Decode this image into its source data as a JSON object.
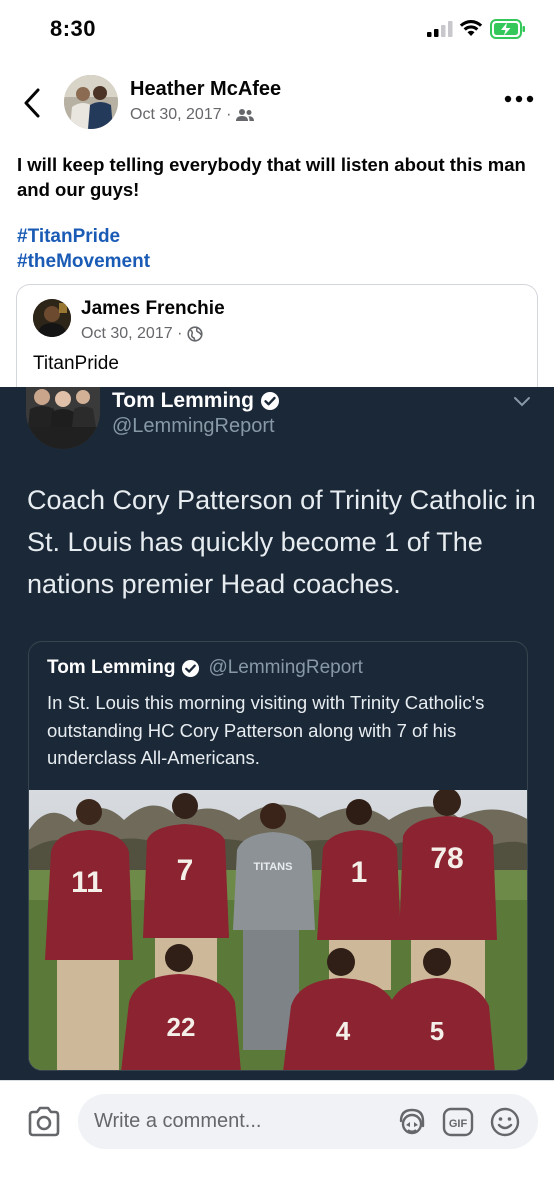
{
  "status_bar": {
    "time": "8:30"
  },
  "post": {
    "author": "Heather McAfee",
    "date": "Oct 30, 2017 ·",
    "text": "I will keep telling everybody that will listen about this man and our guys!",
    "hashtags": [
      "#TitanPride",
      "#theMovement"
    ],
    "icons": {
      "back": "chevron-left-icon",
      "audience": "friends-icon",
      "more": "more-icon"
    }
  },
  "shared": {
    "author": "James Frenchie",
    "date": "Oct 30, 2017 ·",
    "text": "TitanPride",
    "audience_icon": "globe-icon"
  },
  "tweet": {
    "name": "Tom Lemming",
    "handle": "@LemmingReport",
    "text": "Coach Cory Patterson of Trinity Catholic in St. Louis has quickly become 1 of The nations premier Head coaches.",
    "quote": {
      "name": "Tom Lemming",
      "handle": "@LemmingReport",
      "text": "In St. Louis this morning visiting with Trinity Catholic's outstanding HC Cory Patterson along with 7 of his underclass All-Americans."
    },
    "jersey_numbers": [
      "11",
      "7",
      "1",
      "78",
      "22",
      "4",
      "5"
    ],
    "coach_shirt_text": "TITANS"
  },
  "comment_bar": {
    "placeholder": "Write a comment...",
    "gif_label": "GIF"
  },
  "colors": {
    "hashtag": "#1a5bb5",
    "tweet_bg": "#1b2837",
    "meta_gray": "#65676b",
    "battery_green": "#34c759",
    "jersey_maroon": "#8b2430"
  }
}
